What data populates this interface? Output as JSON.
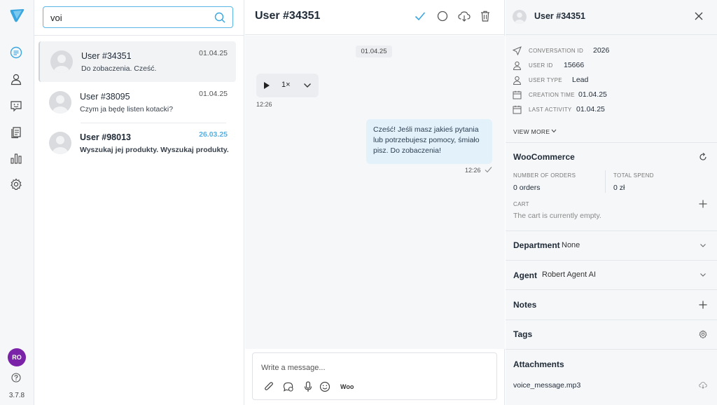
{
  "rail": {
    "version": "3.7.8",
    "user_initials": "RO",
    "nav_items": [
      "conversations-icon",
      "users-icon",
      "chatbot-icon",
      "articles-icon",
      "reports-icon",
      "settings-icon"
    ]
  },
  "list": {
    "search_value": "voi",
    "conversations": [
      {
        "name": "User #34351",
        "message": "Do zobaczenia. Cześć.",
        "date": "01.04.25",
        "active": true,
        "unread": false
      },
      {
        "name": "User #38095",
        "message": "Czym ja będę listen kotacki?",
        "date": "01.04.25",
        "active": false,
        "unread": false
      },
      {
        "name": "User #98013",
        "message": "Wyszukaj jej produkty. Wyszukaj produkty.",
        "date": "26.03.25",
        "active": false,
        "unread": true
      }
    ]
  },
  "chat": {
    "title": "User #34351",
    "date_chip": "01.04.25",
    "audio_speed": "1×",
    "audio_time": "12:26",
    "outgoing_message": "Cześć! Jeśli masz jakieś pytania lub potrzebujesz pomocy, śmiało pisz. Do zobaczenia!",
    "outgoing_time": "12:26",
    "composer_placeholder": "Write a message...",
    "woo_label": "Woo"
  },
  "details": {
    "title": "User #34351",
    "info": [
      {
        "icon": "send-icon",
        "label": "CONVERSATION ID",
        "value": "2026"
      },
      {
        "icon": "user-icon",
        "label": "USER ID",
        "value": "15666"
      },
      {
        "icon": "user-icon",
        "label": "USER TYPE",
        "value": "Lead"
      },
      {
        "icon": "calendar-icon",
        "label": "CREATION TIME",
        "value": "01.04.25"
      },
      {
        "icon": "calendar-icon",
        "label": "LAST ACTIVITY",
        "value": "01.04.25"
      }
    ],
    "view_more": "VIEW MORE",
    "woocommerce": {
      "title": "WooCommerce",
      "orders_label": "NUMBER OF ORDERS",
      "orders_value": "0 orders",
      "spend_label": "TOTAL SPEND",
      "spend_value": "0 zł",
      "cart_label": "CART",
      "cart_empty": "The cart is currently empty."
    },
    "department": {
      "label": "Department",
      "value": "None"
    },
    "agent": {
      "label": "Agent",
      "value": "Robert Agent AI"
    },
    "notes": {
      "label": "Notes"
    },
    "tags": {
      "label": "Tags"
    },
    "attachments": {
      "label": "Attachments",
      "file": "voice_message.mp3"
    }
  },
  "colors": {
    "accent": "#56b0e3",
    "search_border": "#5bb6e6",
    "bubble": "#e3f1fb",
    "avatar": "#7a22a8"
  }
}
